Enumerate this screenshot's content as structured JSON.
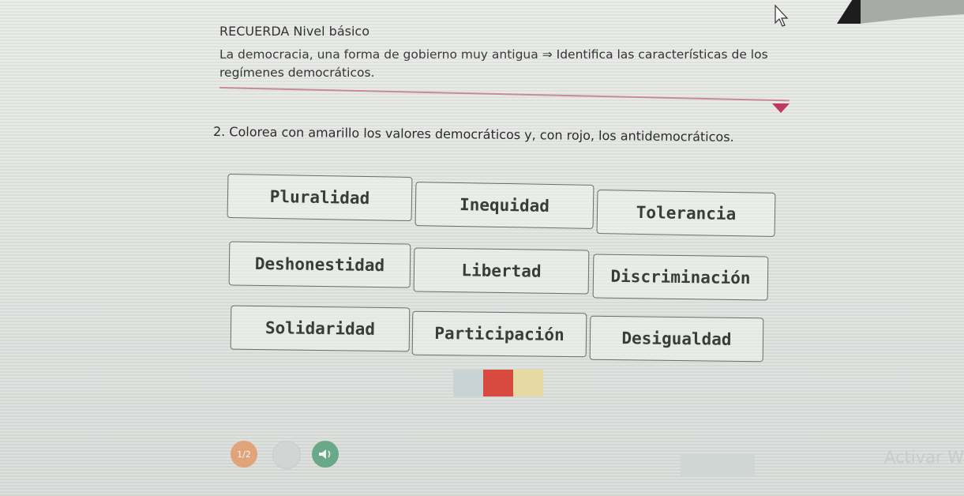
{
  "header": {
    "title": "RECUERDA Nivel básico",
    "breadcrumb_topic": "La democracia, una forma de gobierno muy antigua",
    "breadcrumb_arrow": "⇒",
    "breadcrumb_task": "Identifica las características de los regímenes democráticos."
  },
  "question": "2. Colorea con amarillo los valores democráticos y, con rojo, los antidemocráticos.",
  "words": [
    [
      "Pluralidad",
      "Inequidad",
      "Tolerancia"
    ],
    [
      "Deshonestidad",
      "Libertad",
      "Discriminación"
    ],
    [
      "Solidaridad",
      "Participación",
      "Desigualdad"
    ]
  ],
  "palette": {
    "colors": [
      "#c9d3d6",
      "#d84a3f",
      "#e7d9a3"
    ]
  },
  "footer": {
    "page_indicator": "1/2",
    "watermark": "Activar W"
  },
  "colors": {
    "accent": "#c1385f",
    "red": "#d84a3f",
    "yellow": "#e7d9a3"
  }
}
